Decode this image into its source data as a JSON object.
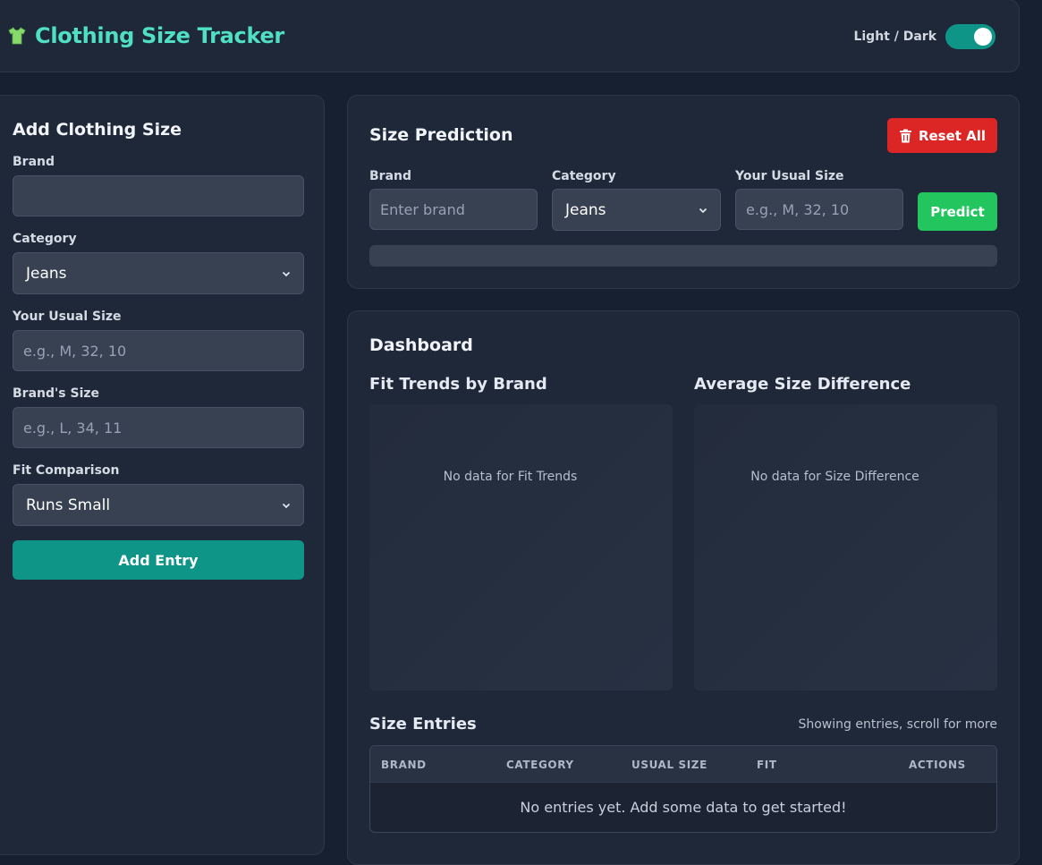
{
  "header": {
    "title": "Clothing Size Tracker",
    "theme_label": "Light / Dark",
    "theme_dark_enabled": true,
    "icon": "tshirt-icon"
  },
  "add_form": {
    "title": "Add Clothing Size",
    "brand_label": "Brand",
    "brand_value": "",
    "category_label": "Category",
    "category_value": "Jeans",
    "usual_size_label": "Your Usual Size",
    "usual_size_placeholder": "e.g., M, 32, 10",
    "brand_size_label": "Brand's Size",
    "brand_size_placeholder": "e.g., L, 34, 11",
    "fit_label": "Fit Comparison",
    "fit_value": "Runs Small",
    "submit_label": "Add Entry"
  },
  "prediction": {
    "title": "Size Prediction",
    "reset_label": "Reset All",
    "brand_label": "Brand",
    "brand_placeholder": "Enter brand",
    "category_label": "Category",
    "category_value": "Jeans",
    "usual_size_label": "Your Usual Size",
    "usual_size_placeholder": "e.g., M, 32, 10",
    "predict_label": "Predict"
  },
  "dashboard": {
    "title": "Dashboard",
    "fit_trends_title": "Fit Trends by Brand",
    "fit_trends_empty": "No data for Fit Trends",
    "size_diff_title": "Average Size Difference",
    "size_diff_empty": "No data for Size Difference",
    "entries_title": "Size Entries",
    "entries_hint": "Showing entries, scroll for more",
    "columns": [
      "BRAND",
      "CATEGORY",
      "USUAL SIZE",
      "FIT",
      "ACTIONS"
    ],
    "empty_message": "No entries yet. Add some data to get started!"
  },
  "colors": {
    "accent": "#0f9488",
    "title": "#4fe0c4",
    "danger": "#dc2626",
    "success": "#22c55e",
    "background": "#172030",
    "card": "#1f2838"
  }
}
